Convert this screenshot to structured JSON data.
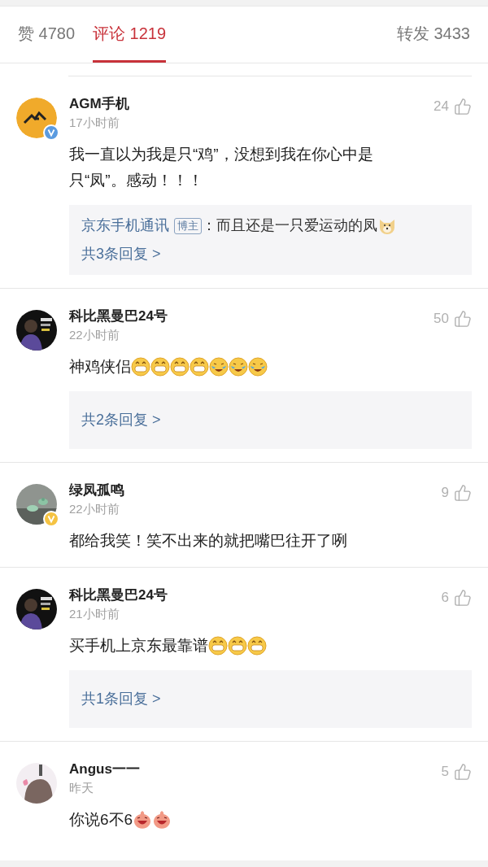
{
  "tabs": [
    {
      "label": "赞 4780",
      "selected": false
    },
    {
      "label": "评论 1219",
      "selected": true
    },
    {
      "label": "转发 3433",
      "selected": false
    }
  ],
  "comments": [
    {
      "avatar": {
        "kind": "logo"
      },
      "verified": {
        "color": "#5b9be0"
      },
      "name": "AGM手机",
      "time": "17小时前",
      "likes": "24",
      "text": "我一直以为我是只“鸡”，没想到我在你心中是只“凤”。感动！！！",
      "replies": {
        "items": [
          {
            "author": "京东手机通讯",
            "tag": "博主",
            "text": "：而且还是一只爱运动的凤",
            "emojis": [
              {
                "kind": "dog"
              }
            ]
          }
        ],
        "more": "共3条回复 >"
      }
    },
    {
      "avatar": {
        "kind": "dark"
      },
      "name": "科比黑曼巴24号",
      "time": "22小时前",
      "likes": "50",
      "text": "神鸡侠侣",
      "emojis": [
        {
          "kind": "grin"
        },
        {
          "kind": "grin"
        },
        {
          "kind": "grin"
        },
        {
          "kind": "grin"
        },
        {
          "kind": "laugh-cry"
        },
        {
          "kind": "laugh-cry"
        },
        {
          "kind": "laugh-cry"
        }
      ],
      "replies": {
        "more": "共2条回复 >"
      }
    },
    {
      "avatar": {
        "kind": "grey"
      },
      "verified": {
        "color": "#f5c342"
      },
      "name": "绿凤孤鸣",
      "time": "22小时前",
      "likes": "9",
      "text": "都给我笑！笑不出来的就把嘴巴往开了咧"
    },
    {
      "avatar": {
        "kind": "dark"
      },
      "name": "科比黑曼巴24号",
      "time": "21小时前",
      "likes": "6",
      "text": "买手机上京东最靠谱",
      "emojis": [
        {
          "kind": "grin"
        },
        {
          "kind": "grin"
        },
        {
          "kind": "grin"
        }
      ],
      "replies": {
        "more": "共1条回复 >"
      }
    },
    {
      "avatar": {
        "kind": "pink"
      },
      "name": "Angus一一",
      "time": "昨天",
      "likes": "5",
      "text": "你说6不6",
      "emojis": [
        {
          "kind": "pig"
        },
        {
          "kind": "pig"
        }
      ]
    }
  ]
}
